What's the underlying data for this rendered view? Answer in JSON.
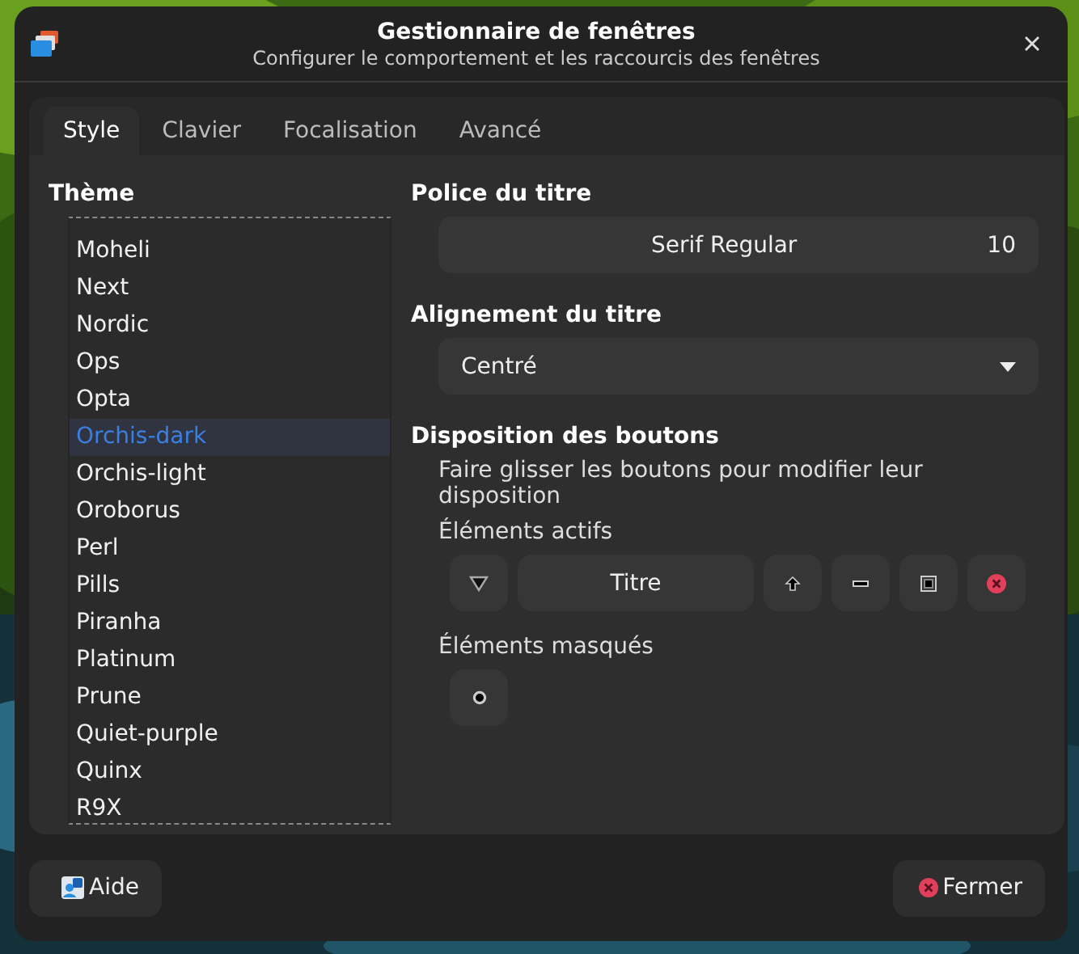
{
  "window": {
    "title": "Gestionnaire de fenêtres",
    "subtitle": "Configurer le comportement et les raccourcis des fenêtres"
  },
  "tabs": [
    {
      "label": "Style",
      "selected": true
    },
    {
      "label": "Clavier",
      "selected": false
    },
    {
      "label": "Focalisation",
      "selected": false
    },
    {
      "label": "Avancé",
      "selected": false
    }
  ],
  "theme": {
    "label": "Thème",
    "items": [
      {
        "name": "Moheli",
        "selected": false
      },
      {
        "name": "Next",
        "selected": false
      },
      {
        "name": "Nordic",
        "selected": false
      },
      {
        "name": "Ops",
        "selected": false
      },
      {
        "name": "Opta",
        "selected": false
      },
      {
        "name": "Orchis-dark",
        "selected": true
      },
      {
        "name": "Orchis-light",
        "selected": false
      },
      {
        "name": "Oroborus",
        "selected": false
      },
      {
        "name": "Perl",
        "selected": false
      },
      {
        "name": "Pills",
        "selected": false
      },
      {
        "name": "Piranha",
        "selected": false
      },
      {
        "name": "Platinum",
        "selected": false
      },
      {
        "name": "Prune",
        "selected": false
      },
      {
        "name": "Quiet-purple",
        "selected": false
      },
      {
        "name": "Quinx",
        "selected": false
      },
      {
        "name": "R9X",
        "selected": false
      }
    ]
  },
  "title_font": {
    "label": "Police du titre",
    "font": "Serif Regular",
    "size": "10"
  },
  "title_alignment": {
    "label": "Alignement du titre",
    "value": "Centré"
  },
  "button_layout": {
    "label": "Disposition des boutons",
    "hint": "Faire glisser les boutons pour modifier leur disposition",
    "active_label": "Éléments actifs",
    "active": [
      {
        "kind": "menu"
      },
      {
        "kind": "title",
        "label": "Titre"
      },
      {
        "kind": "shade"
      },
      {
        "kind": "minimize"
      },
      {
        "kind": "maximize"
      },
      {
        "kind": "close"
      }
    ],
    "hidden_label": "Éléments masqués",
    "hidden": [
      {
        "kind": "stick"
      }
    ]
  },
  "footer": {
    "help": "Aide",
    "close": "Fermer"
  }
}
